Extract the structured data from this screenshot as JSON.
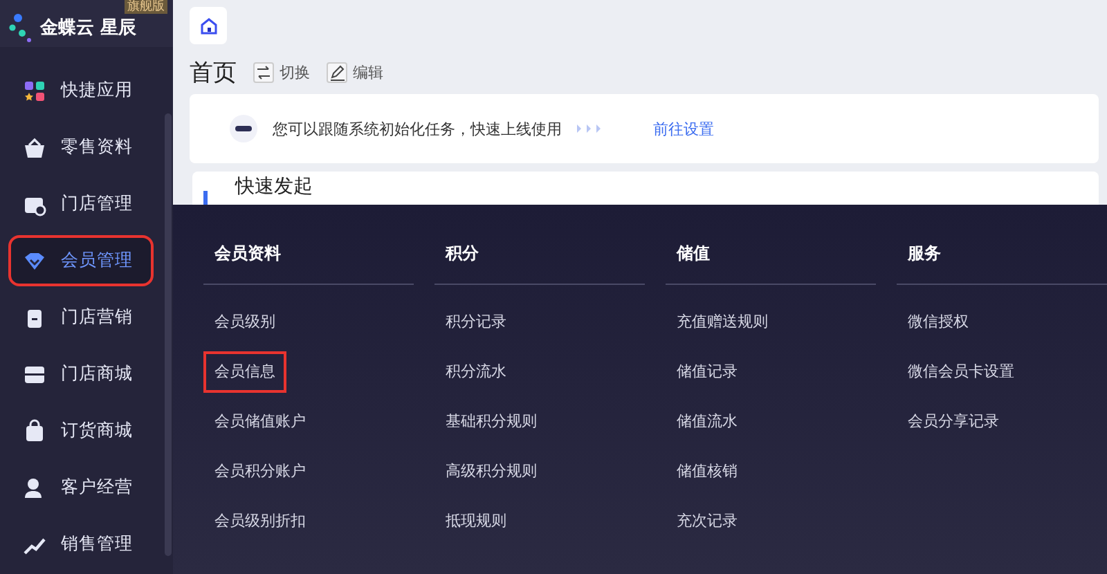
{
  "brand": {
    "name": "金蝶云 星辰",
    "badge": "旗舰版"
  },
  "sidebar": {
    "items": [
      {
        "label": "快捷应用",
        "selected": false,
        "highlighted": false
      },
      {
        "label": "零售资料",
        "selected": false,
        "highlighted": false
      },
      {
        "label": "门店管理",
        "selected": false,
        "highlighted": false
      },
      {
        "label": "会员管理",
        "selected": true,
        "highlighted": true
      },
      {
        "label": "门店营销",
        "selected": false,
        "highlighted": false
      },
      {
        "label": "门店商城",
        "selected": false,
        "highlighted": false
      },
      {
        "label": "订货商城",
        "selected": false,
        "highlighted": false
      },
      {
        "label": "客户经营",
        "selected": false,
        "highlighted": false
      },
      {
        "label": "销售管理",
        "selected": false,
        "highlighted": false
      }
    ]
  },
  "page": {
    "title": "首页",
    "actions": [
      {
        "kind": "switch",
        "label": "切换"
      },
      {
        "kind": "edit",
        "label": "编辑"
      }
    ],
    "notice": {
      "text": "您可以跟随系统初始化任务，快速上线使用",
      "link": "前往设置"
    },
    "section_title": "快速发起"
  },
  "menu": {
    "columns": [
      {
        "title": "会员资料",
        "items": [
          {
            "label": "会员级别",
            "highlighted": false
          },
          {
            "label": "会员信息",
            "highlighted": true
          },
          {
            "label": "会员储值账户",
            "highlighted": false
          },
          {
            "label": "会员积分账户",
            "highlighted": false
          },
          {
            "label": "会员级别折扣",
            "highlighted": false
          }
        ]
      },
      {
        "title": "积分",
        "items": [
          {
            "label": "积分记录",
            "highlighted": false
          },
          {
            "label": "积分流水",
            "highlighted": false
          },
          {
            "label": "基础积分规则",
            "highlighted": false
          },
          {
            "label": "高级积分规则",
            "highlighted": false
          },
          {
            "label": "抵现规则",
            "highlighted": false
          }
        ]
      },
      {
        "title": "储值",
        "items": [
          {
            "label": "充值赠送规则",
            "highlighted": false
          },
          {
            "label": "储值记录",
            "highlighted": false
          },
          {
            "label": "储值流水",
            "highlighted": false
          },
          {
            "label": "储值核销",
            "highlighted": false
          },
          {
            "label": "充次记录",
            "highlighted": false
          }
        ]
      },
      {
        "title": "服务",
        "items": [
          {
            "label": "微信授权",
            "highlighted": false
          },
          {
            "label": "微信会员卡设置",
            "highlighted": false
          },
          {
            "label": "会员分享记录",
            "highlighted": false
          }
        ]
      }
    ]
  }
}
